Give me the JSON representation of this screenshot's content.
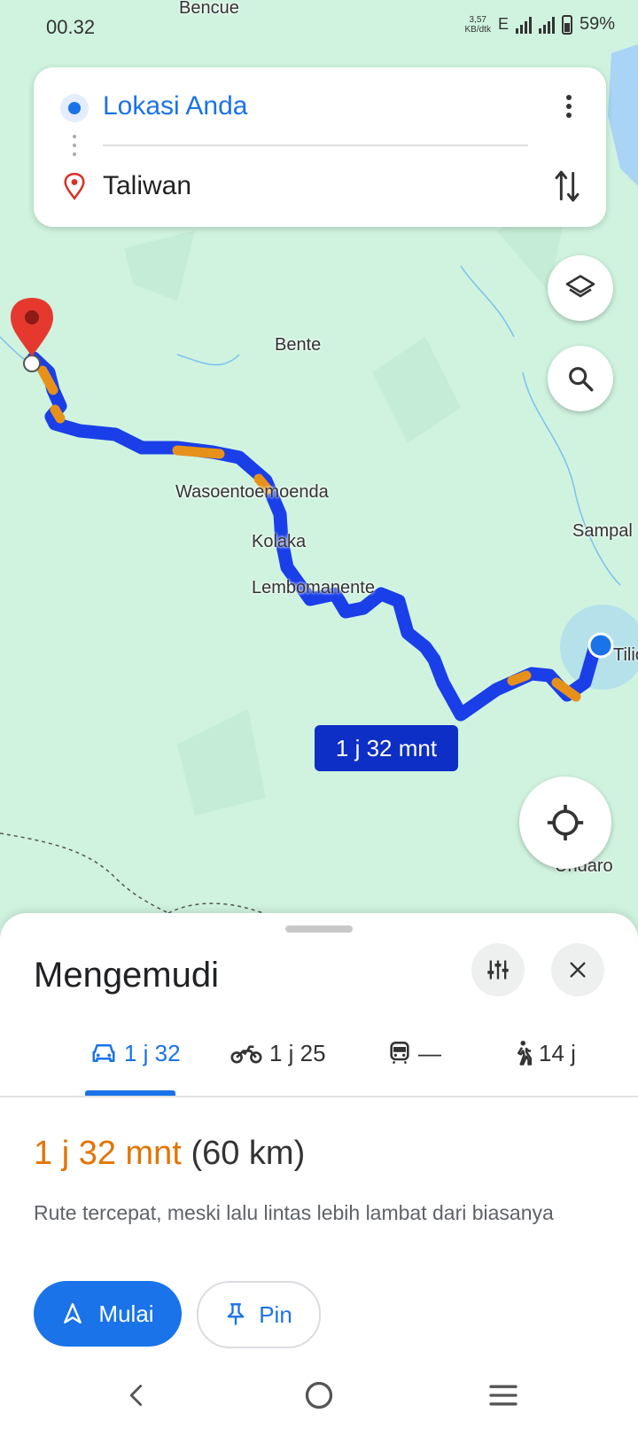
{
  "status_bar": {
    "time": "00.32",
    "network_speed": "3,57",
    "network_unit": "KB/dtk",
    "network_type": "E",
    "battery": "59%"
  },
  "search_card": {
    "origin": "Lokasi Anda",
    "destination": "Taliwan",
    "more_icon": "more-vert-icon",
    "swap_icon": "swap-icon"
  },
  "map": {
    "labels": {
      "bencue": "Bencue",
      "bente": "Bente",
      "wasoentoemoenda": "Wasoentoemoenda",
      "kolaka": "Kolaka",
      "lembomanente": "Lembomanente",
      "sampal": "Sampal",
      "undaro": "Undaro",
      "tiliom": "Tiliom"
    },
    "eta_badge": "1 j 32 mnt",
    "route_color": "#1a3fe8",
    "traffic_color": "#e8911a"
  },
  "sheet": {
    "title": "Mengemudi",
    "modes": [
      {
        "icon": "car-icon",
        "label": "1 j 32"
      },
      {
        "icon": "motorcycle-icon",
        "label": "1 j 25"
      },
      {
        "icon": "train-icon",
        "label": "—"
      },
      {
        "icon": "walk-icon",
        "label": "14 j"
      }
    ],
    "summary_time": "1 j 32 mnt",
    "summary_distance": "(60 km)",
    "description": "Rute tercepat, meski lalu lintas lebih lambat dari biasanya",
    "start_label": "Mulai",
    "pin_label": "Pin"
  },
  "colors": {
    "accent": "#1a73e8",
    "delay": "#e37400"
  }
}
